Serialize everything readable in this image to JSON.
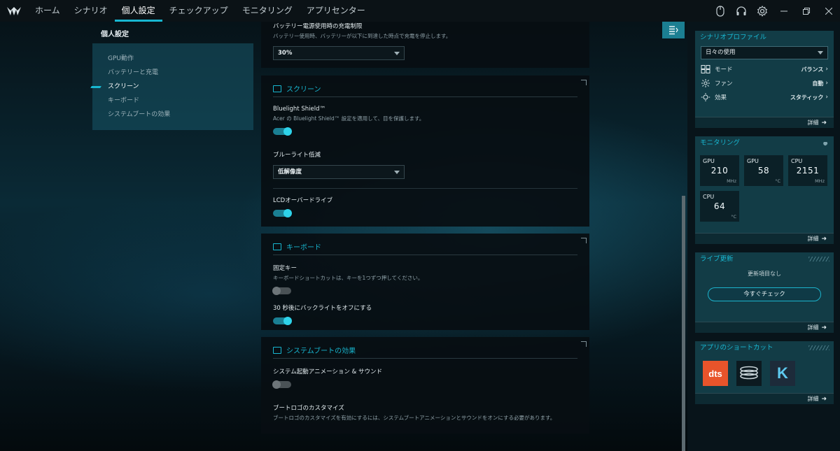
{
  "nav": {
    "tabs": [
      "ホーム",
      "シナリオ",
      "個人設定",
      "チェックアップ",
      "モニタリング",
      "アプリセンター"
    ],
    "active_tab": 2,
    "icons": [
      "mouse-icon",
      "headset-icon",
      "settings-gear-icon"
    ]
  },
  "left": {
    "title": "個人設定",
    "items": [
      "GPU動作",
      "バッテリーと充電",
      "スクリーン",
      "キーボード",
      "システムブートの効果"
    ],
    "active": 2
  },
  "battery": {
    "title": "バッテリー電源使用時の充電制限",
    "desc": "バッテリー使用時、バッテリーが以下に到達した時点で充電を停止します。",
    "value": "30%"
  },
  "screen": {
    "section_title": "スクリーン",
    "bluelight_title": "Bluelight Shield™",
    "bluelight_desc": "Acer の Bluelight Shield™ 設定を適用して、目を保護します。",
    "bluelight_on": true,
    "reduction_title": "ブルーライト低減",
    "reduction_value": "低解像度",
    "lcd_title": "LCDオーバードライブ",
    "lcd_on": true
  },
  "keyboard": {
    "section_title": "キーボード",
    "sticky_title": "固定キー",
    "sticky_desc": "キーボードショートカットは、キーを1つずつ押してください。",
    "sticky_on": false,
    "backlight_title": "30 秒後にバックライトをオフにする",
    "backlight_on": true
  },
  "boot": {
    "section_title": "システムブートの効果",
    "anim_title": "システム起動アニメーション & サウンド",
    "anim_on": false,
    "logo_title": "ブートロゴのカスタマイズ",
    "logo_desc": "ブートロゴのカスタマイズを有効にするには、システムブートアニメーションとサウンドをオンにする必要があります。"
  },
  "sidebar": {
    "scenario": {
      "title": "シナリオプロファイル",
      "profile": "日々の使用",
      "rows": [
        {
          "label": "モード",
          "value": "バランス",
          "icon": "grid-icon"
        },
        {
          "label": "ファン",
          "value": "自動",
          "icon": "fan-icon"
        },
        {
          "label": "効果",
          "value": "スタティック",
          "icon": "sun-icon"
        }
      ],
      "details": "詳細"
    },
    "monitoring": {
      "title": "モニタリング",
      "stats": [
        {
          "label": "GPU",
          "value": "210",
          "unit": "MHz"
        },
        {
          "label": "GPU",
          "value": "58",
          "unit": "°C"
        },
        {
          "label": "CPU",
          "value": "2151",
          "unit": "MHz"
        },
        {
          "label": "CPU",
          "value": "64",
          "unit": "°C"
        }
      ],
      "details": "詳細"
    },
    "live_update": {
      "title": "ライブ更新",
      "status": "更新項目なし",
      "button": "今すぐチェック",
      "details": "詳細"
    },
    "shortcuts": {
      "title": "アプリのショートカット",
      "apps": [
        "dts",
        "sense-app",
        "killer-app"
      ],
      "dts_label": "dts",
      "k_label": "K",
      "details": "詳細"
    }
  },
  "colors": {
    "accent": "#18b7d1",
    "dts": "#e8542b",
    "killer": "#1d2b3a"
  }
}
